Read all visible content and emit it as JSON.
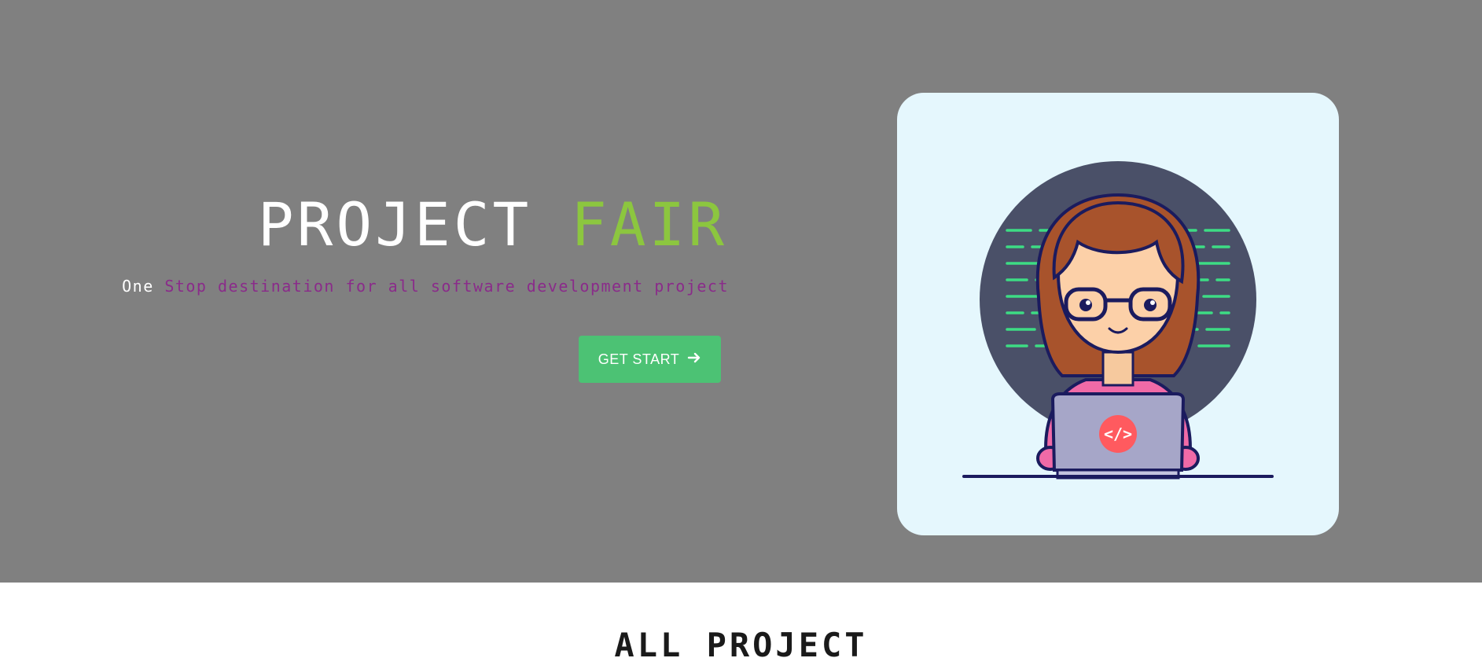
{
  "hero": {
    "title_main": "PROJECT ",
    "title_accent": "FAIR",
    "subtitle_first": "One ",
    "subtitle_rest": "Stop destination for all software development project",
    "button_label": "GET START",
    "button_icon": "arrow-right-icon",
    "illustration": "girl-coding-on-laptop-illustration",
    "laptop_logo": "</>"
  },
  "section": {
    "title": "ALL PROJECT"
  },
  "colors": {
    "hero_bg": "#808080",
    "accent_green": "#8cc63f",
    "subtitle_purple": "#8a2b8a",
    "button_bg": "#4cc274",
    "card_bg": "#e5f7fd"
  }
}
